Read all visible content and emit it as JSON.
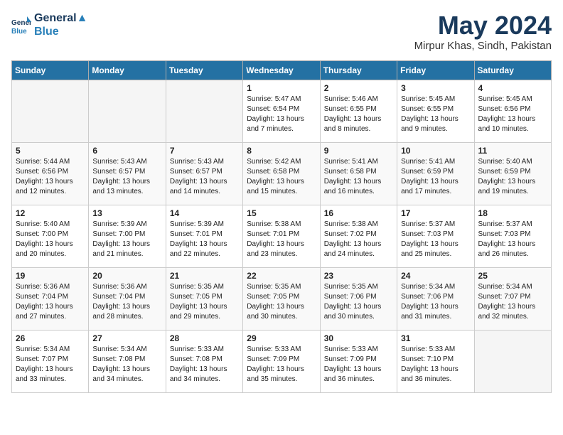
{
  "header": {
    "logo_line1": "General",
    "logo_line2": "Blue",
    "month": "May 2024",
    "location": "Mirpur Khas, Sindh, Pakistan"
  },
  "weekdays": [
    "Sunday",
    "Monday",
    "Tuesday",
    "Wednesday",
    "Thursday",
    "Friday",
    "Saturday"
  ],
  "weeks": [
    [
      {
        "day": "",
        "info": ""
      },
      {
        "day": "",
        "info": ""
      },
      {
        "day": "",
        "info": ""
      },
      {
        "day": "1",
        "info": "Sunrise: 5:47 AM\nSunset: 6:54 PM\nDaylight: 13 hours\nand 7 minutes."
      },
      {
        "day": "2",
        "info": "Sunrise: 5:46 AM\nSunset: 6:55 PM\nDaylight: 13 hours\nand 8 minutes."
      },
      {
        "day": "3",
        "info": "Sunrise: 5:45 AM\nSunset: 6:55 PM\nDaylight: 13 hours\nand 9 minutes."
      },
      {
        "day": "4",
        "info": "Sunrise: 5:45 AM\nSunset: 6:56 PM\nDaylight: 13 hours\nand 10 minutes."
      }
    ],
    [
      {
        "day": "5",
        "info": "Sunrise: 5:44 AM\nSunset: 6:56 PM\nDaylight: 13 hours\nand 12 minutes."
      },
      {
        "day": "6",
        "info": "Sunrise: 5:43 AM\nSunset: 6:57 PM\nDaylight: 13 hours\nand 13 minutes."
      },
      {
        "day": "7",
        "info": "Sunrise: 5:43 AM\nSunset: 6:57 PM\nDaylight: 13 hours\nand 14 minutes."
      },
      {
        "day": "8",
        "info": "Sunrise: 5:42 AM\nSunset: 6:58 PM\nDaylight: 13 hours\nand 15 minutes."
      },
      {
        "day": "9",
        "info": "Sunrise: 5:41 AM\nSunset: 6:58 PM\nDaylight: 13 hours\nand 16 minutes."
      },
      {
        "day": "10",
        "info": "Sunrise: 5:41 AM\nSunset: 6:59 PM\nDaylight: 13 hours\nand 17 minutes."
      },
      {
        "day": "11",
        "info": "Sunrise: 5:40 AM\nSunset: 6:59 PM\nDaylight: 13 hours\nand 19 minutes."
      }
    ],
    [
      {
        "day": "12",
        "info": "Sunrise: 5:40 AM\nSunset: 7:00 PM\nDaylight: 13 hours\nand 20 minutes."
      },
      {
        "day": "13",
        "info": "Sunrise: 5:39 AM\nSunset: 7:00 PM\nDaylight: 13 hours\nand 21 minutes."
      },
      {
        "day": "14",
        "info": "Sunrise: 5:39 AM\nSunset: 7:01 PM\nDaylight: 13 hours\nand 22 minutes."
      },
      {
        "day": "15",
        "info": "Sunrise: 5:38 AM\nSunset: 7:01 PM\nDaylight: 13 hours\nand 23 minutes."
      },
      {
        "day": "16",
        "info": "Sunrise: 5:38 AM\nSunset: 7:02 PM\nDaylight: 13 hours\nand 24 minutes."
      },
      {
        "day": "17",
        "info": "Sunrise: 5:37 AM\nSunset: 7:03 PM\nDaylight: 13 hours\nand 25 minutes."
      },
      {
        "day": "18",
        "info": "Sunrise: 5:37 AM\nSunset: 7:03 PM\nDaylight: 13 hours\nand 26 minutes."
      }
    ],
    [
      {
        "day": "19",
        "info": "Sunrise: 5:36 AM\nSunset: 7:04 PM\nDaylight: 13 hours\nand 27 minutes."
      },
      {
        "day": "20",
        "info": "Sunrise: 5:36 AM\nSunset: 7:04 PM\nDaylight: 13 hours\nand 28 minutes."
      },
      {
        "day": "21",
        "info": "Sunrise: 5:35 AM\nSunset: 7:05 PM\nDaylight: 13 hours\nand 29 minutes."
      },
      {
        "day": "22",
        "info": "Sunrise: 5:35 AM\nSunset: 7:05 PM\nDaylight: 13 hours\nand 30 minutes."
      },
      {
        "day": "23",
        "info": "Sunrise: 5:35 AM\nSunset: 7:06 PM\nDaylight: 13 hours\nand 30 minutes."
      },
      {
        "day": "24",
        "info": "Sunrise: 5:34 AM\nSunset: 7:06 PM\nDaylight: 13 hours\nand 31 minutes."
      },
      {
        "day": "25",
        "info": "Sunrise: 5:34 AM\nSunset: 7:07 PM\nDaylight: 13 hours\nand 32 minutes."
      }
    ],
    [
      {
        "day": "26",
        "info": "Sunrise: 5:34 AM\nSunset: 7:07 PM\nDaylight: 13 hours\nand 33 minutes."
      },
      {
        "day": "27",
        "info": "Sunrise: 5:34 AM\nSunset: 7:08 PM\nDaylight: 13 hours\nand 34 minutes."
      },
      {
        "day": "28",
        "info": "Sunrise: 5:33 AM\nSunset: 7:08 PM\nDaylight: 13 hours\nand 34 minutes."
      },
      {
        "day": "29",
        "info": "Sunrise: 5:33 AM\nSunset: 7:09 PM\nDaylight: 13 hours\nand 35 minutes."
      },
      {
        "day": "30",
        "info": "Sunrise: 5:33 AM\nSunset: 7:09 PM\nDaylight: 13 hours\nand 36 minutes."
      },
      {
        "day": "31",
        "info": "Sunrise: 5:33 AM\nSunset: 7:10 PM\nDaylight: 13 hours\nand 36 minutes."
      },
      {
        "day": "",
        "info": ""
      }
    ]
  ]
}
